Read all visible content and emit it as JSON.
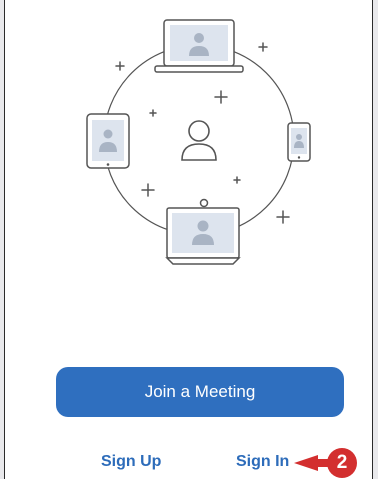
{
  "main": {
    "join_button_label": "Join a Meeting",
    "sign_up_label": "Sign Up",
    "sign_in_label": "Sign In"
  },
  "callout": {
    "number": "2",
    "color": "#d32f2f"
  },
  "colors": {
    "primary_button": "#2f6fbf",
    "link": "#2d6cba",
    "illustration_stroke": "#555555",
    "illustration_fill": "#dde4ee"
  },
  "icons": [
    "laptop-icon",
    "tablet-icon",
    "phone-icon",
    "user-icon",
    "room-display-icon",
    "plus-sparkle-icon"
  ]
}
